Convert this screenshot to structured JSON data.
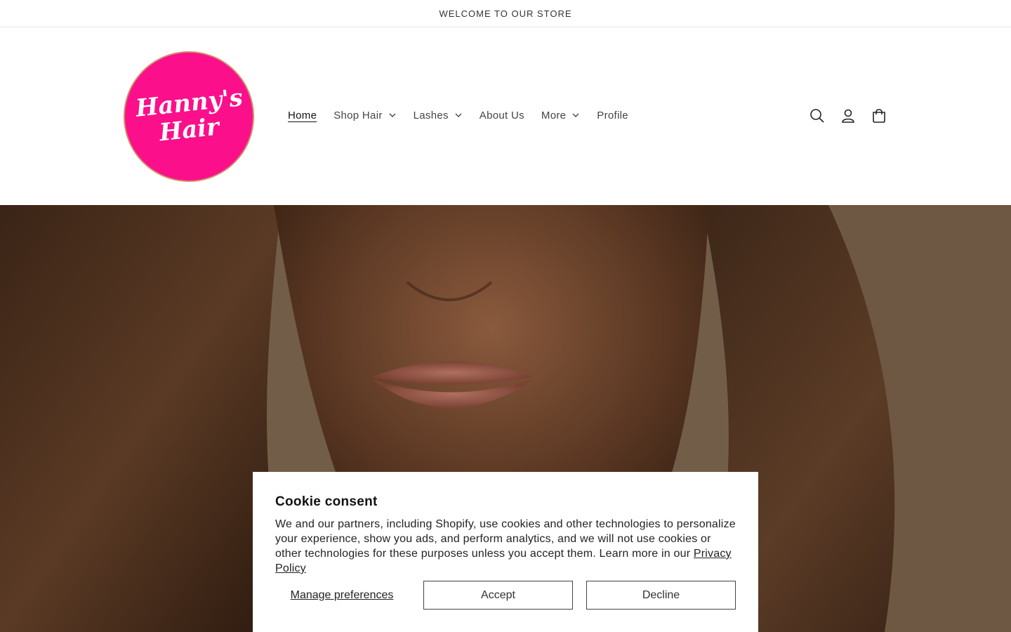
{
  "announcement": {
    "text": "WELCOME TO OUR STORE"
  },
  "logo": {
    "line1": "Hanny's",
    "line2": "Hair",
    "color": "#fb0f8a"
  },
  "nav": {
    "items": [
      {
        "label": "Home",
        "active": true,
        "dropdown": false
      },
      {
        "label": "Shop Hair",
        "active": false,
        "dropdown": true
      },
      {
        "label": "Lashes",
        "active": false,
        "dropdown": true
      },
      {
        "label": "About Us",
        "active": false,
        "dropdown": false
      },
      {
        "label": "More",
        "active": false,
        "dropdown": true
      },
      {
        "label": "Profile",
        "active": false,
        "dropdown": false
      }
    ]
  },
  "header_icons": [
    "search-icon",
    "account-icon",
    "cart-icon"
  ],
  "cookie": {
    "title": "Cookie consent",
    "body": "We and our partners, including Shopify, use cookies and other technologies to personalize your experience, show you ads, and perform analytics, and we will not use cookies or other technologies for these purposes unless you accept them. Learn more in our ",
    "link": "Privacy Policy",
    "manage": "Manage preferences",
    "accept": "Accept",
    "decline": "Decline"
  }
}
